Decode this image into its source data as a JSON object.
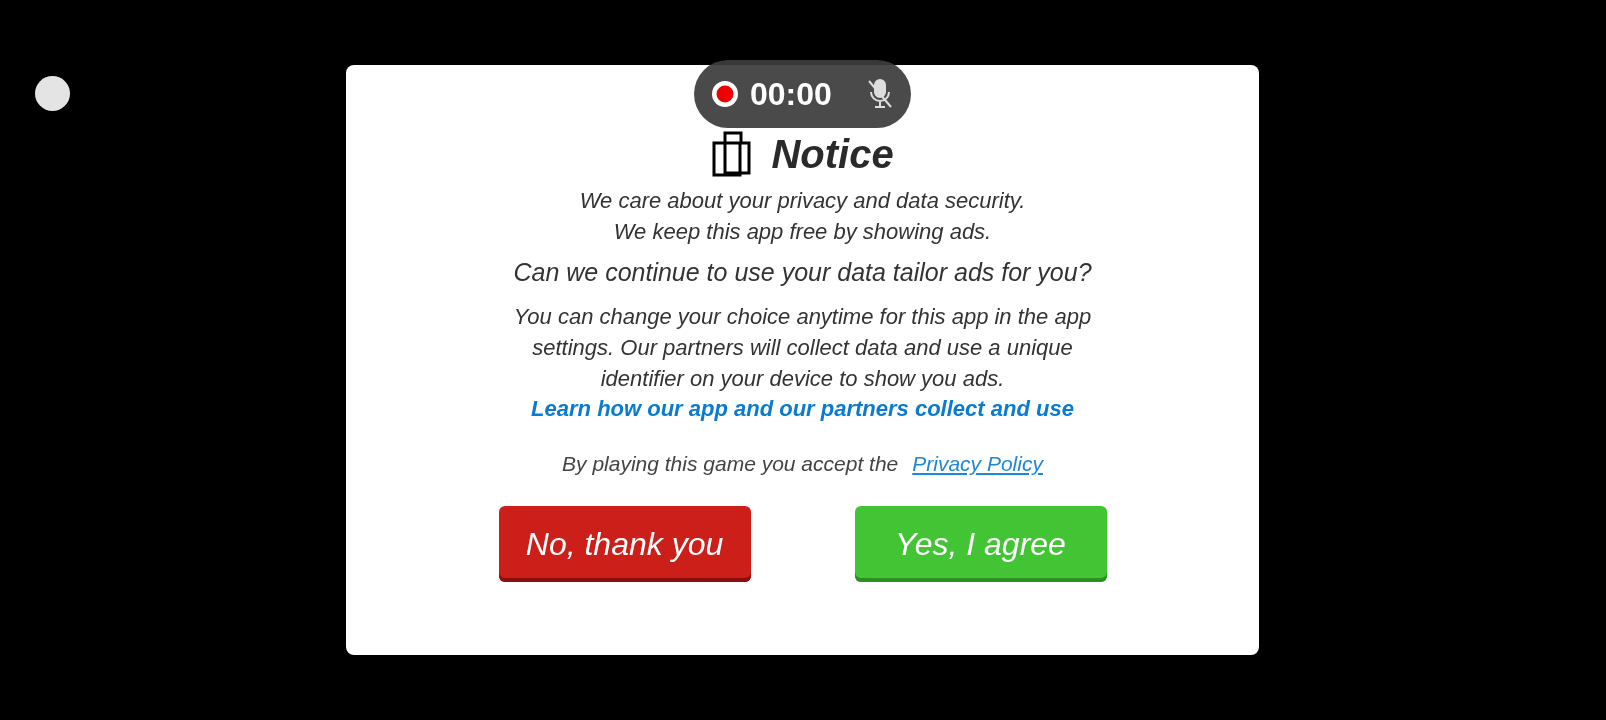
{
  "recorder": {
    "time": "00:00"
  },
  "dialog": {
    "title": "Notice",
    "intro": [
      "We care about your privacy and data security.",
      "We keep this app free by showing ads."
    ],
    "question": "Can we continue to use your data tailor ads for you?",
    "details": "You can change your choice anytime for this app in the app settings. Our partners will collect data and use a unique identifier on your device to show you ads.",
    "learn_link": "Learn how our app and our partners collect and use",
    "consent_text": "By playing this game you accept the",
    "policy_link": "Privacy Policy",
    "buttons": [
      {
        "label": "No, thank you",
        "kind": "decline"
      },
      {
        "label": "Yes, I agree",
        "kind": "accept"
      }
    ]
  }
}
